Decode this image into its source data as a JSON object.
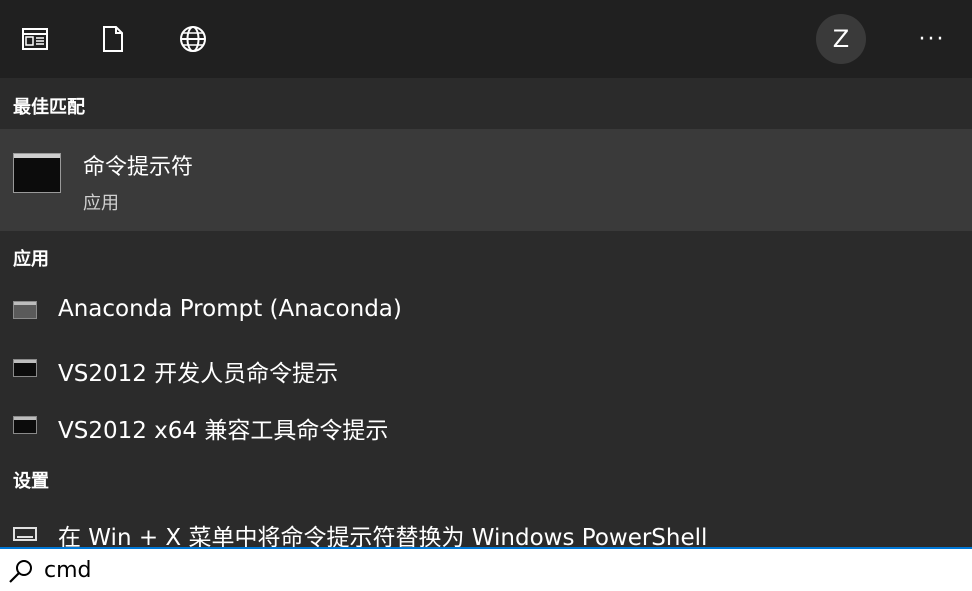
{
  "topbar": {
    "icons": [
      "apps-icon",
      "documents-icon",
      "web-icon"
    ],
    "avatar_initial": "Z",
    "more_label": "···"
  },
  "best_match": {
    "header": "最佳匹配",
    "title": "命令提示符",
    "subtitle": "应用"
  },
  "apps": {
    "header": "应用",
    "items": [
      {
        "label": "Anaconda Prompt (Anaconda)"
      },
      {
        "label": "VS2012 开发人员命令提示"
      },
      {
        "label": "VS2012 x64 兼容工具命令提示"
      }
    ]
  },
  "settings": {
    "header": "设置",
    "items": [
      {
        "label": "在 Win + X 菜单中将命令提示符替换为 Windows PowerShell"
      }
    ]
  },
  "search": {
    "value": "cmd"
  },
  "colors": {
    "accent": "#0078d7",
    "background": "#2b2b2b",
    "topbar": "#202020",
    "selected": "#3a3a3a"
  }
}
